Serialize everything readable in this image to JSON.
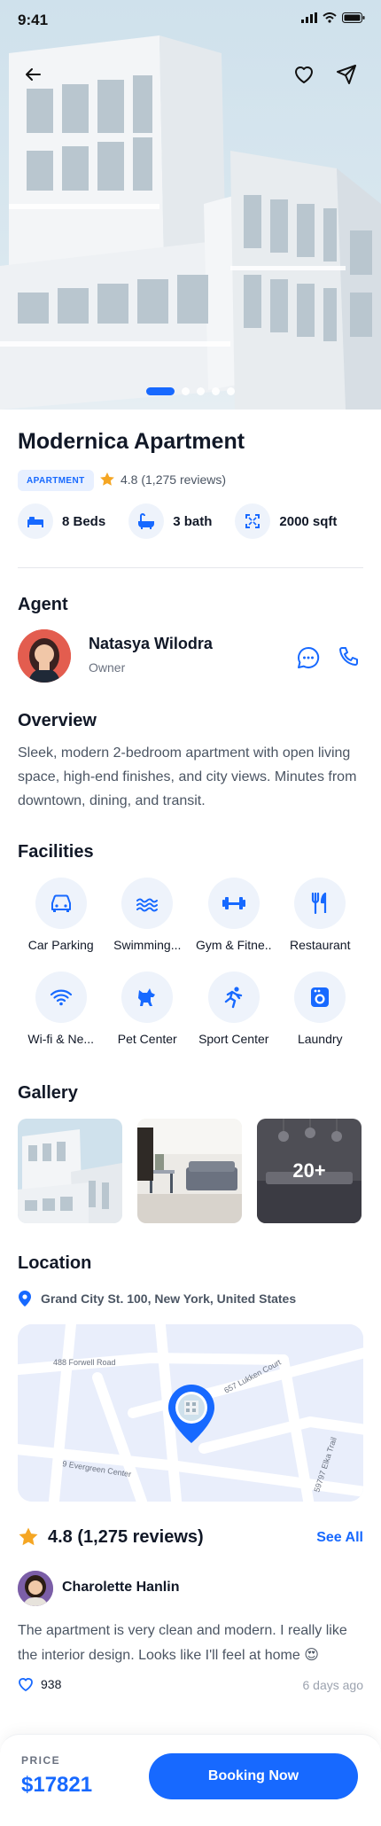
{
  "status": {
    "time": "9:41"
  },
  "hero": {
    "image_icon": "apartment-building-photo",
    "slide_count": 5,
    "active_slide": 1
  },
  "property": {
    "title": "Modernica Apartment",
    "type_badge": "APARTMENT",
    "rating_text": "4.8 (1,275 reviews)",
    "specs": [
      {
        "icon": "bed-icon",
        "label": "8 Beds"
      },
      {
        "icon": "bath-icon",
        "label": "3 bath"
      },
      {
        "icon": "area-icon",
        "label": "2000 sqft"
      }
    ]
  },
  "agent": {
    "section_title": "Agent",
    "name": "Natasya Wilodra",
    "role": "Owner"
  },
  "overview": {
    "section_title": "Overview",
    "text": "Sleek, modern 2-bedroom apartment with open living space, high-end finishes, and city views. Minutes from downtown, dining, and transit."
  },
  "facilities": {
    "section_title": "Facilities",
    "items": [
      {
        "icon": "car-icon",
        "label": "Car Parking"
      },
      {
        "icon": "swimming-icon",
        "label": "Swimming..."
      },
      {
        "icon": "dumbbell-icon",
        "label": "Gym & Fitne.."
      },
      {
        "icon": "restaurant-icon",
        "label": "Restaurant"
      },
      {
        "icon": "wifi-icon",
        "label": "Wi-fi & Ne..."
      },
      {
        "icon": "pet-icon",
        "label": "Pet Center"
      },
      {
        "icon": "sport-icon",
        "label": "Sport Center"
      },
      {
        "icon": "laundry-icon",
        "label": "Laundry"
      }
    ]
  },
  "gallery": {
    "section_title": "Gallery",
    "more_label": "20+"
  },
  "location": {
    "section_title": "Location",
    "address": "Grand City St. 100, New York, United States",
    "streets": [
      "488 Forwell Road",
      "657 Lukken Court",
      "9 Evergreen Center",
      "59797 Elka Trail"
    ]
  },
  "reviews": {
    "summary": "4.8 (1,275 reviews)",
    "see_all": "See All",
    "reviewer": "Charolette Hanlin",
    "text": "The apartment is very clean and modern. I really like the interior design. Looks like I'll feel at home 😍",
    "likes": "938",
    "time_ago": "6 days ago"
  },
  "booking": {
    "price_label": "PRICE",
    "price": "$17821",
    "button": "Booking Now"
  },
  "colors": {
    "accent": "#1769ff",
    "star": "#f5a623"
  }
}
